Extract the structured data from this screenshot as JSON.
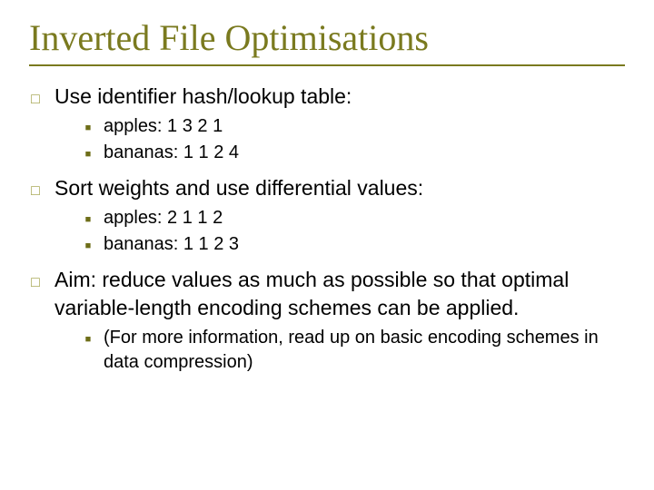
{
  "title": "Inverted File Optimisations",
  "points": [
    {
      "text": "Use identifier hash/lookup table:",
      "sub": [
        "apples: 1 3 2 1",
        "bananas: 1 1 2 4"
      ]
    },
    {
      "text": "Sort weights and use differential values:",
      "sub": [
        "apples: 2 1 1 2",
        "bananas: 1 1 2 3"
      ]
    },
    {
      "text": "Aim: reduce values as much as possible so that optimal variable-length encoding schemes can be applied.",
      "sub": [
        "(For more information, read up on basic encoding schemes in data compression)"
      ]
    }
  ]
}
